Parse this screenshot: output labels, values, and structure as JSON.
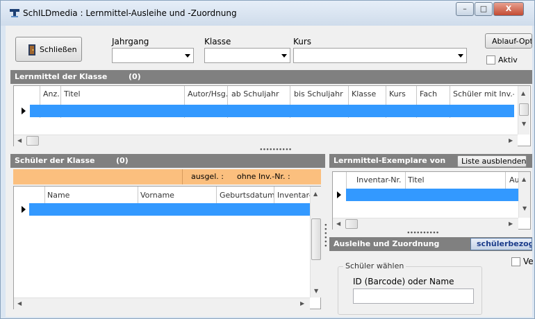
{
  "window": {
    "title": "SchILDmedia : Lernmittel-Ausleihe und -Zuordnung",
    "minimize": "–",
    "maximize": "□",
    "close": "X"
  },
  "toolbar": {
    "close_button": "Schließen",
    "jahrgang_label": "Jahrgang",
    "jahrgang_value": "",
    "klasse_label": "Klasse",
    "klasse_value": "",
    "kurs_label": "Kurs",
    "kurs_value": "",
    "ablauf_button": "Ablauf-Opti",
    "aktiv_label": "Aktiv"
  },
  "lernmittel": {
    "header": "Lernmittel der Klasse",
    "count": "(0)",
    "columns": [
      "Anz.",
      "Titel",
      "Autor/Hsg.",
      "ab Schuljahr",
      "bis Schuljahr",
      "Klasse",
      "Kurs",
      "Fach",
      "Schüler mit Inv.-I"
    ]
  },
  "schueler": {
    "header": "Schüler der Klasse",
    "count": "(0)",
    "ausgel_label": "ausgel. :",
    "ohne_inv_label": "ohne Inv.-Nr. :",
    "columns": [
      "Name",
      "Vorname",
      "Geburtsdatum",
      "Inventar-"
    ]
  },
  "exemplare": {
    "header": "Lernmittel-Exemplare von",
    "hide_button": "Liste ausblenden",
    "columns": [
      "Inventar-Nr.",
      "Titel",
      "Au"
    ]
  },
  "ausleihe": {
    "header": "Ausleihe und Zuordnung",
    "tab_button": "schülerbezog",
    "ve_label": "Ve",
    "group_title": "Schüler wählen",
    "id_label": "ID (Barcode) oder Name",
    "id_value": ""
  }
}
